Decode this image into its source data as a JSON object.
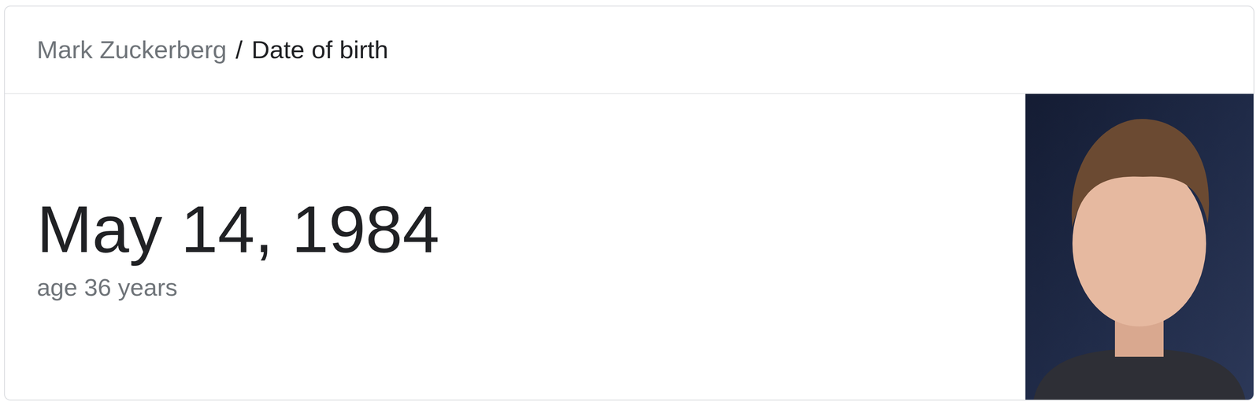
{
  "breadcrumb": {
    "entity": "Mark Zuckerberg",
    "separator": "/",
    "attribute": "Date of birth"
  },
  "answer": "May 14, 1984",
  "subtitle": "age 36 years"
}
